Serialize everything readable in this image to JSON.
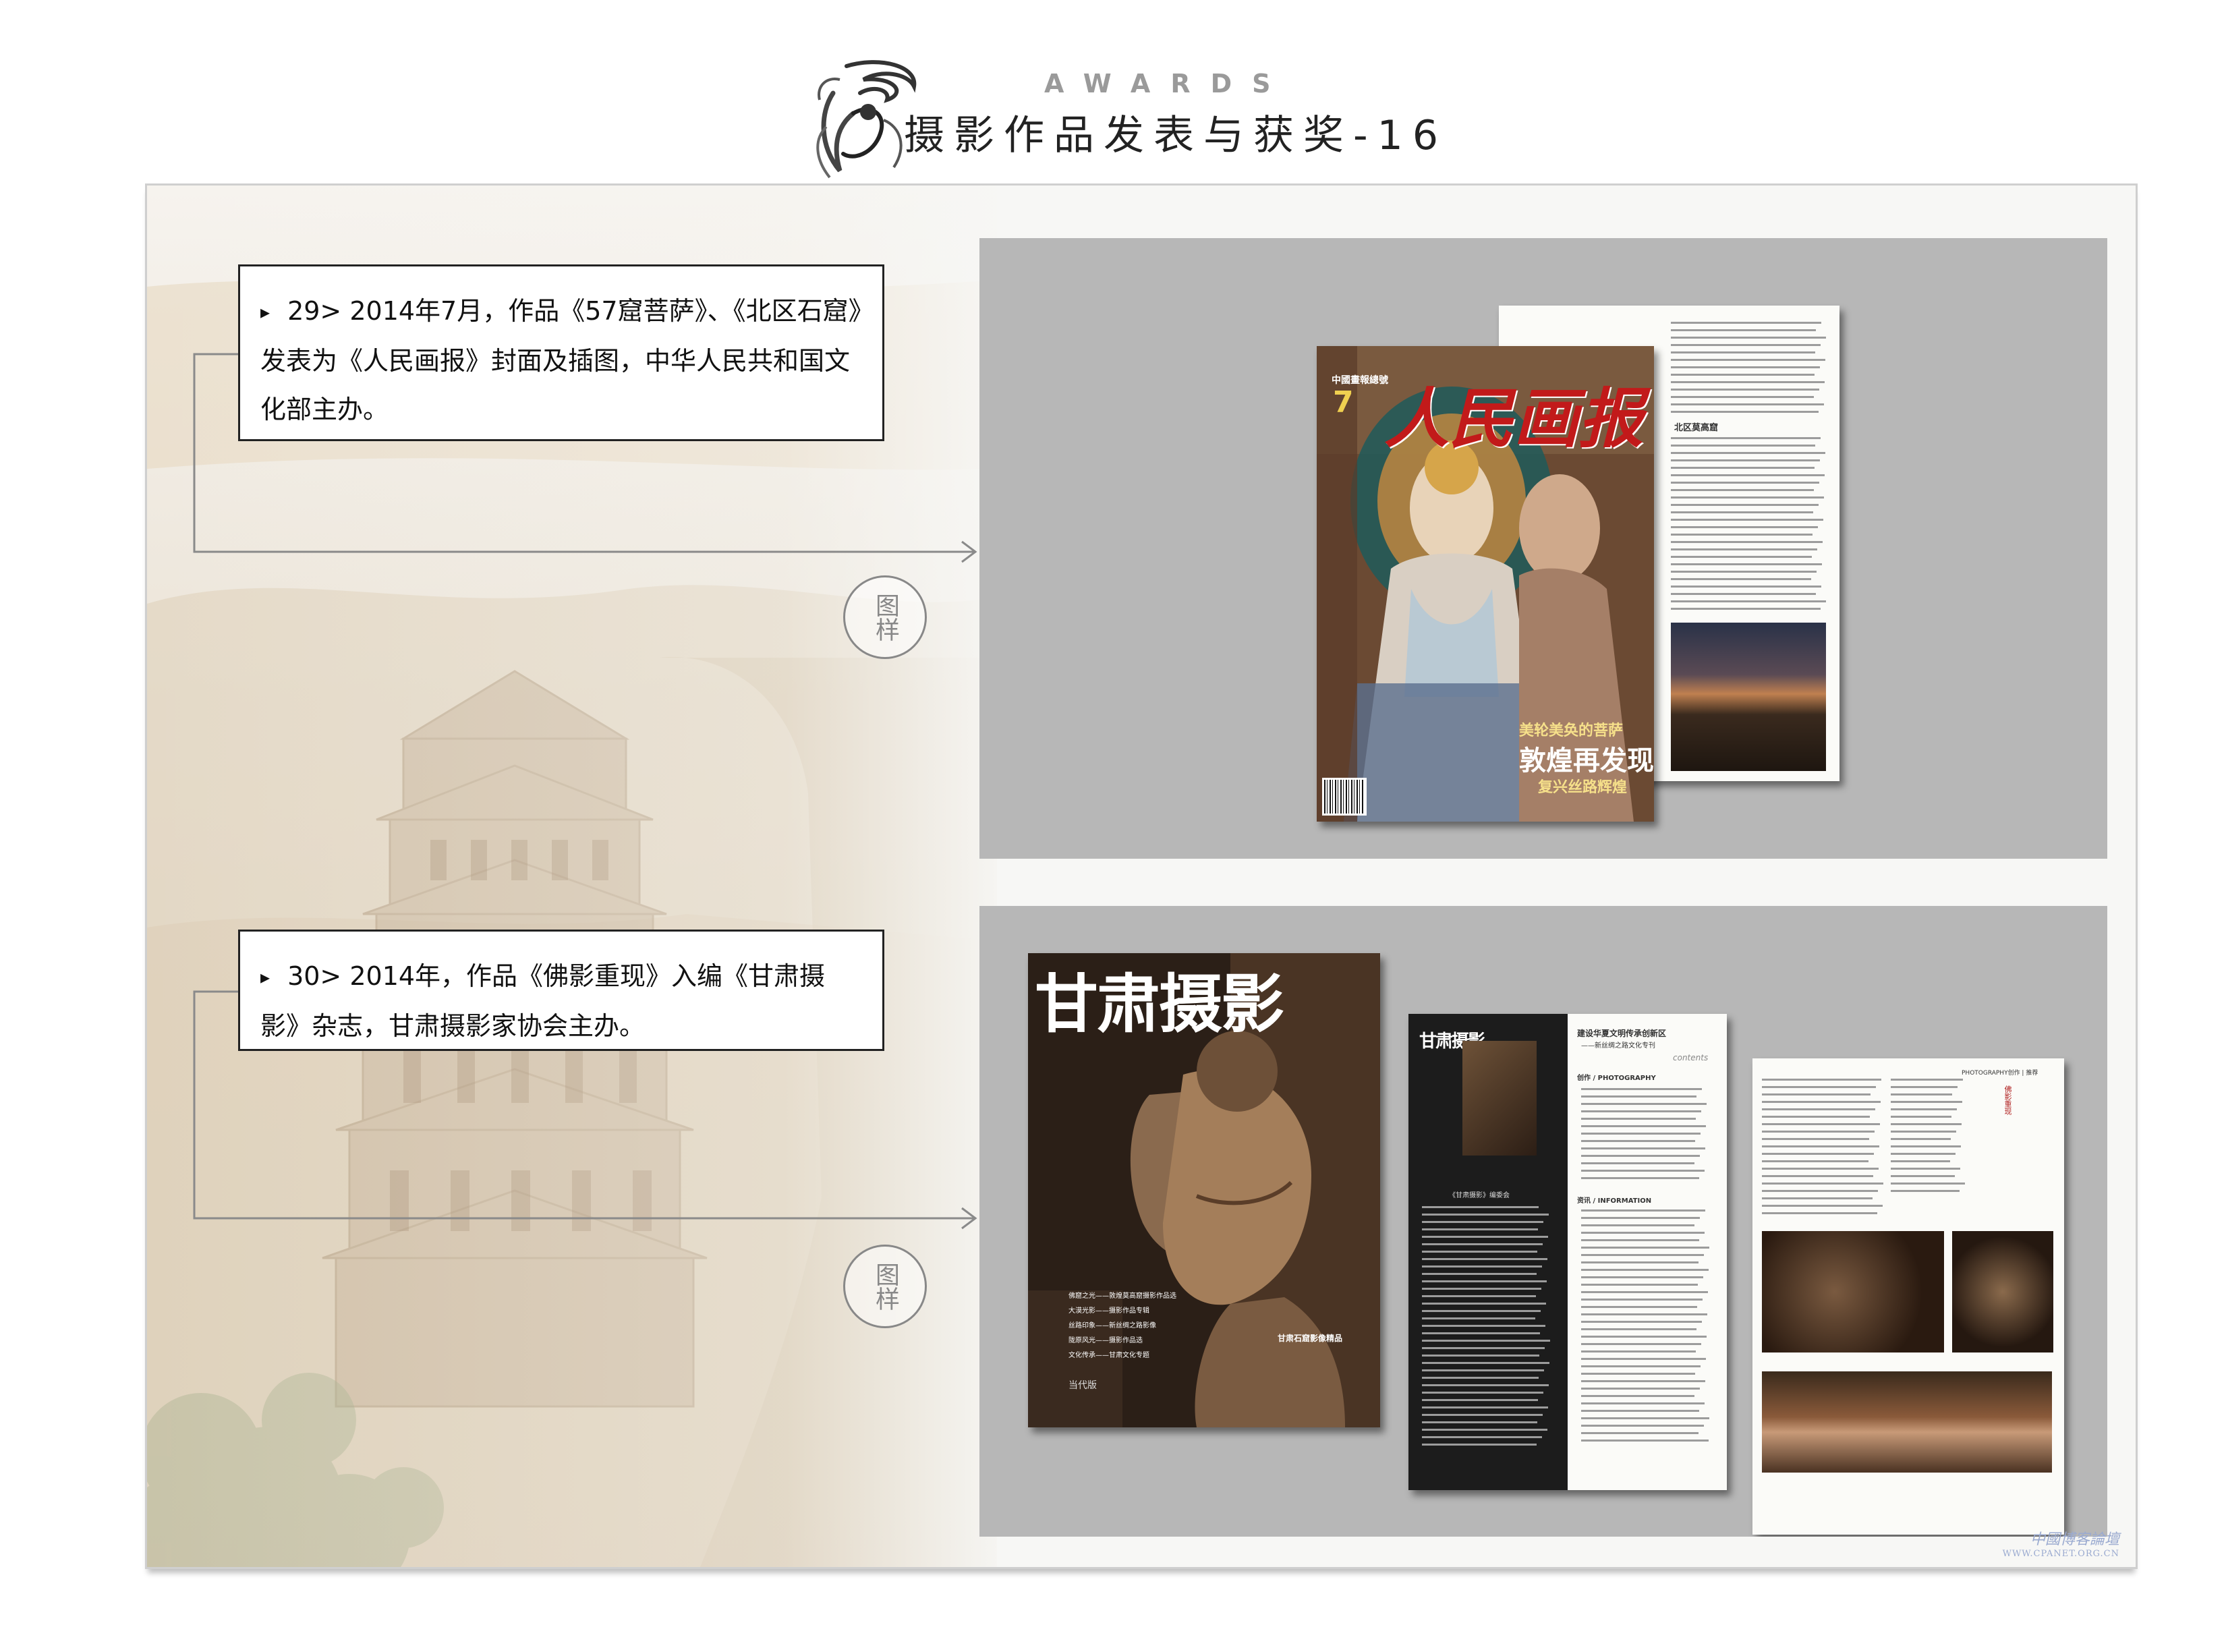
{
  "header": {
    "eyebrow": "AWARDS",
    "title": "摄影作品发表与获奖-16"
  },
  "items": [
    {
      "marker": "▸",
      "text": "29> 2014年7月，作品《57窟菩萨》、《北区石窟》发表为《人民画报》封面及插图，中华人民共和国文化部主办。",
      "stamp": "图样"
    },
    {
      "marker": "▸",
      "text": "30> 2014年，作品《佛影重现》入编《甘肃摄影》杂志，甘肃摄影家协会主办。",
      "stamp": "图样"
    }
  ],
  "magazine1": {
    "masthead": "人民画报",
    "top_label": "中國畫報總號",
    "issue": "7",
    "headline_small": "美轮美奂的菩萨",
    "headline": "敦煌再发现",
    "sub_headline": "复兴丝路辉煌",
    "spread_heading": "北区莫高窟"
  },
  "magazine2": {
    "masthead": "甘肃摄影",
    "edition": "当代版",
    "toc_word": "contents",
    "toc_title": "建设华夏文明传承创新区",
    "toc_subtitle": "——新丝绸之路文化专刊",
    "toc_section1": "创作 / PHOTOGRAPHY",
    "toc_section2": "资讯 / INFORMATION",
    "toc_editorial": "《甘肃摄影》编委会",
    "feature_label": "PHOTOGRAPHY创作 | 推荐",
    "feature_title": "佛影重现",
    "cover_lines": [
      "佛窟之光——敦煌莫高窟摄影作品选",
      "大漠光影——摄影作品专辑",
      "丝路印象——新丝绸之路影像",
      "陇原风光——摄影作品选",
      "文化传承——甘肃文化专题"
    ],
    "cover_caption": "甘肃石窟影像精品"
  },
  "watermark": {
    "text": "中國博客論壇",
    "sub": "WWW.CPANET.ORG.CN"
  },
  "colors": {
    "panel": "#b7b7b7",
    "masthead_red": "#c21a1a",
    "caption_border": "#222222"
  }
}
